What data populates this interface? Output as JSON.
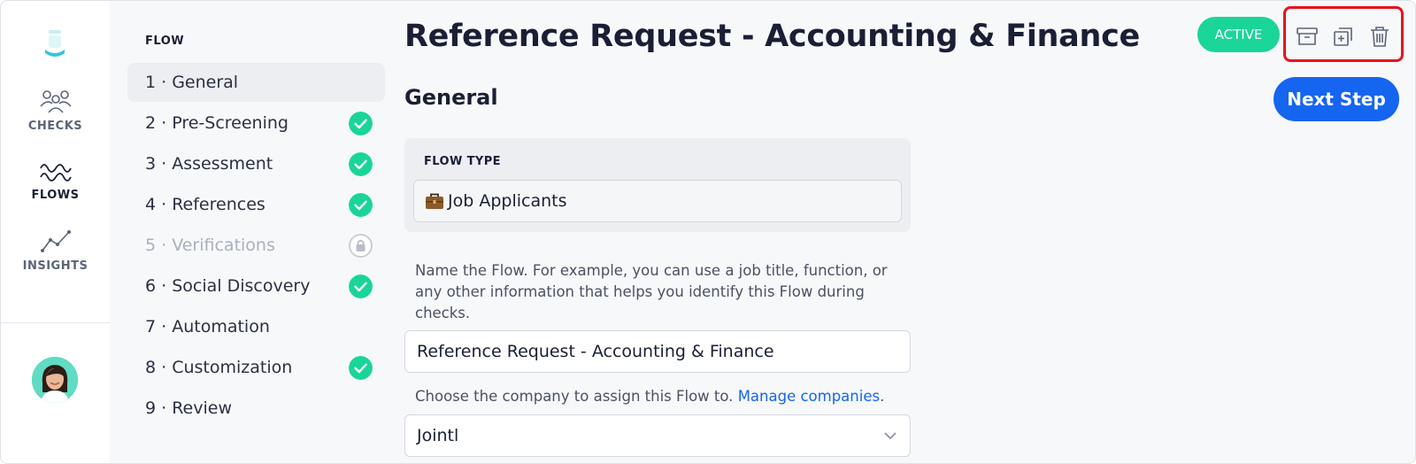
{
  "nav": {
    "items": [
      {
        "label": "CHECKS",
        "icon": "people-icon"
      },
      {
        "label": "FLOWS",
        "icon": "waves-icon"
      },
      {
        "label": "INSIGHTS",
        "icon": "line-chart-icon"
      }
    ]
  },
  "steps": {
    "heading": "FLOW",
    "items": [
      {
        "label": "1 · General",
        "state": "selected"
      },
      {
        "label": "2 · Pre-Screening",
        "state": "done"
      },
      {
        "label": "3 · Assessment",
        "state": "done"
      },
      {
        "label": "4 · References",
        "state": "done"
      },
      {
        "label": "5 · Verifications",
        "state": "locked"
      },
      {
        "label": "6 · Social Discovery",
        "state": "done"
      },
      {
        "label": "7 · Automation",
        "state": "none"
      },
      {
        "label": "8 · Customization",
        "state": "done"
      },
      {
        "label": "9 · Review",
        "state": "none"
      }
    ]
  },
  "header": {
    "title": "Reference Request - Accounting & Finance",
    "status": "ACTIVE",
    "actions": [
      "archive-icon",
      "duplicate-icon",
      "trash-icon"
    ]
  },
  "main": {
    "section_title": "General",
    "next_label": "Next Step",
    "flow_type_label": "FLOW TYPE",
    "flow_type_value": "Job Applicants",
    "flow_type_icon": "briefcase-icon",
    "name_help": "Name the Flow. For example, you can use a job title, function, or any other information that helps you identify this Flow during checks.",
    "name_value": "Reference Request - Accounting & Finance",
    "company_help": "Choose the company to assign this Flow to.",
    "company_link": "Manage companies",
    "company_link_suffix": ".",
    "company_value": "Jointl"
  },
  "colors": {
    "accent": "#1565f0",
    "success": "#1ad598",
    "highlight": "#e8101e"
  }
}
